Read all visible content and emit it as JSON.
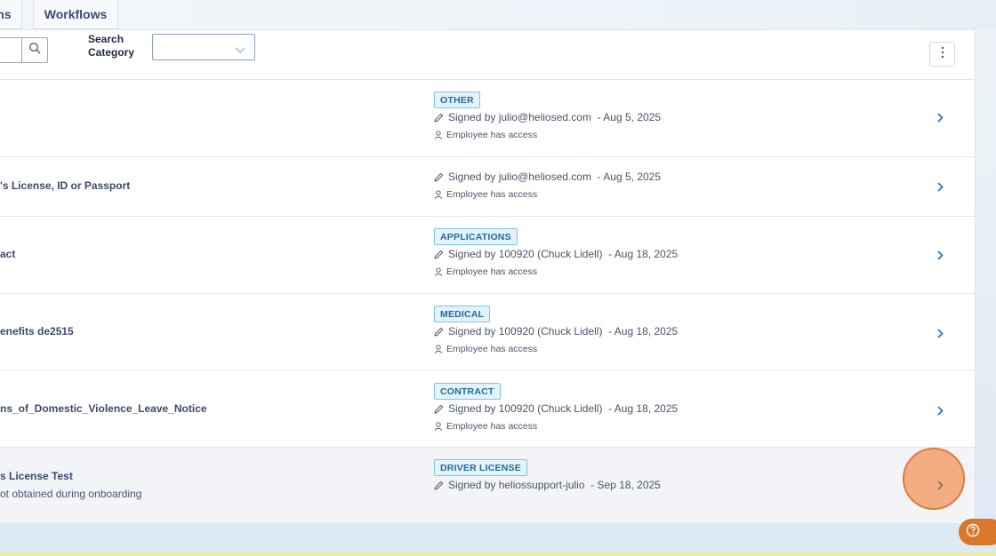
{
  "tabs": [
    {
      "label": "ms"
    },
    {
      "label": "Workflows"
    }
  ],
  "toolbar": {
    "search_category_label": "Search Category",
    "search_category_value": ""
  },
  "documents": [
    {
      "title": "",
      "subtitle": "",
      "category": "OTHER",
      "signed_by": "Signed by julio@heliosed.com",
      "signed_date": "- Aug 5, 2025",
      "access": "Employee has access"
    },
    {
      "title": "'s License, ID or Passport",
      "subtitle": "",
      "category": "",
      "signed_by": "Signed by julio@heliosed.com",
      "signed_date": "- Aug 5, 2025",
      "access": "Employee has access"
    },
    {
      "title": "act",
      "subtitle": "",
      "category": "APPLICATIONS",
      "signed_by": "Signed by 100920 (Chuck Lidell)",
      "signed_date": "- Aug 18, 2025",
      "access": "Employee has access"
    },
    {
      "title": "enefits de2515",
      "subtitle": "",
      "category": "MEDICAL",
      "signed_by": "Signed by 100920 (Chuck Lidell)",
      "signed_date": "- Aug 18, 2025",
      "access": "Employee has access"
    },
    {
      "title": "ns_of_Domestic_Violence_Leave_Notice",
      "subtitle": "",
      "category": "CONTRACT",
      "signed_by": "Signed by 100920 (Chuck Lidell)",
      "signed_date": "- Aug 18, 2025",
      "access": "Employee has access"
    },
    {
      "title": "s License Test",
      "subtitle": "ot obtained during onboarding",
      "category": "DRIVER LICENSE",
      "signed_by": "Signed by heliossupport-julio",
      "signed_date": "- Sep 18, 2025",
      "access": ""
    }
  ],
  "icons": {
    "search": "search-icon",
    "select_chevron": "chevron-down-icon",
    "menu": "kebab-menu-icon",
    "signed": "pencil-icon",
    "access": "person-icon",
    "row_action": "chevron-right-icon",
    "help": "help-icon"
  },
  "colors": {
    "accent": "#1f6aa0",
    "badge_bg": "#e3f3fb",
    "highlight_row": "#f2f4f8",
    "help_button": "#d9772b"
  }
}
